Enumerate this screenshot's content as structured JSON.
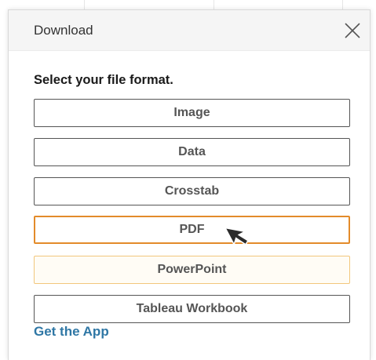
{
  "dialog": {
    "title": "Download",
    "close_icon": "close-x-icon",
    "prompt": "Select your file format.",
    "formats": [
      {
        "label": "Image",
        "state": "default"
      },
      {
        "label": "Data",
        "state": "default"
      },
      {
        "label": "Crosstab",
        "state": "default"
      },
      {
        "label": "PDF",
        "state": "selected"
      },
      {
        "label": "PowerPoint",
        "state": "hover"
      },
      {
        "label": "Tableau Workbook",
        "state": "default"
      }
    ],
    "get_app_link": "Get the App"
  },
  "colors": {
    "selected_border": "#e38b2a",
    "hover_border": "#f2c77c",
    "link": "#2f77a5",
    "button_text": "#555555"
  },
  "cursor": {
    "icon": "mouse-pointer-icon"
  }
}
